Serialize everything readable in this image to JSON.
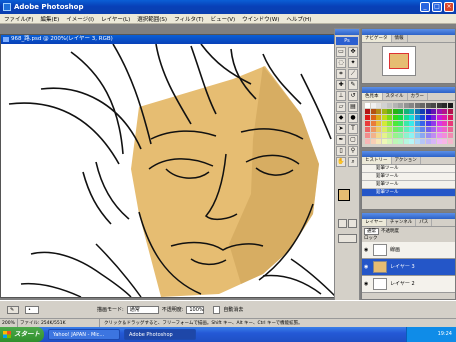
{
  "window": {
    "title": "Adobe Photoshop",
    "min": "_",
    "max": "□",
    "close": "×"
  },
  "menu": [
    "ファイル(F)",
    "編集(E)",
    "イメージ(I)",
    "レイヤー(L)",
    "選択範囲(S)",
    "フィルタ(T)",
    "ビュー(V)",
    "ウインドウ(W)",
    "ヘルプ(H)"
  ],
  "document": {
    "title": "968_路.psd @ 200%(レイヤー 3, RGB)"
  },
  "navigator": {
    "tabs": [
      "ナビゲータ",
      "情報"
    ]
  },
  "swatches": {
    "tabs": [
      "色見本",
      "スタイル",
      "カラー"
    ]
  },
  "history": {
    "tabs": [
      "ヒストリー",
      "アクション"
    ],
    "rows": [
      "鉛筆ツール",
      "鉛筆ツール",
      "鉛筆ツール",
      "鉛筆ツール"
    ]
  },
  "layers": {
    "tabs": [
      "レイヤー",
      "チャンネル",
      "パス"
    ],
    "blend_mode": "通常",
    "opacity_label": "不透明度",
    "lock_label": "ロック",
    "items": [
      {
        "name": "線画"
      },
      {
        "name": "レイヤー 3"
      },
      {
        "name": "レイヤー 2"
      }
    ]
  },
  "options": {
    "mode_label": "描画モード:",
    "mode_value": "通常",
    "opacity_label": "不透明度:",
    "opacity_value": "100%",
    "auto_erase": "自動消去"
  },
  "status": {
    "zoom": "200%",
    "file": "ファイル: 254K/551K",
    "hint": "クリック＆ドラッグすると、フリーフォームで描画。Shift キー、Alt キー、Ctrl キーで機能拡張。"
  },
  "taskbar": {
    "start": "スタート",
    "tasks": [
      "Yahoo! JAPAN - Mic...",
      "Adobe Photoshop"
    ],
    "time": "19:24"
  },
  "colors": {
    "skin": "#e6bd72",
    "skin_shadow": "#caa055",
    "titlebar": "#0a4fc4"
  }
}
